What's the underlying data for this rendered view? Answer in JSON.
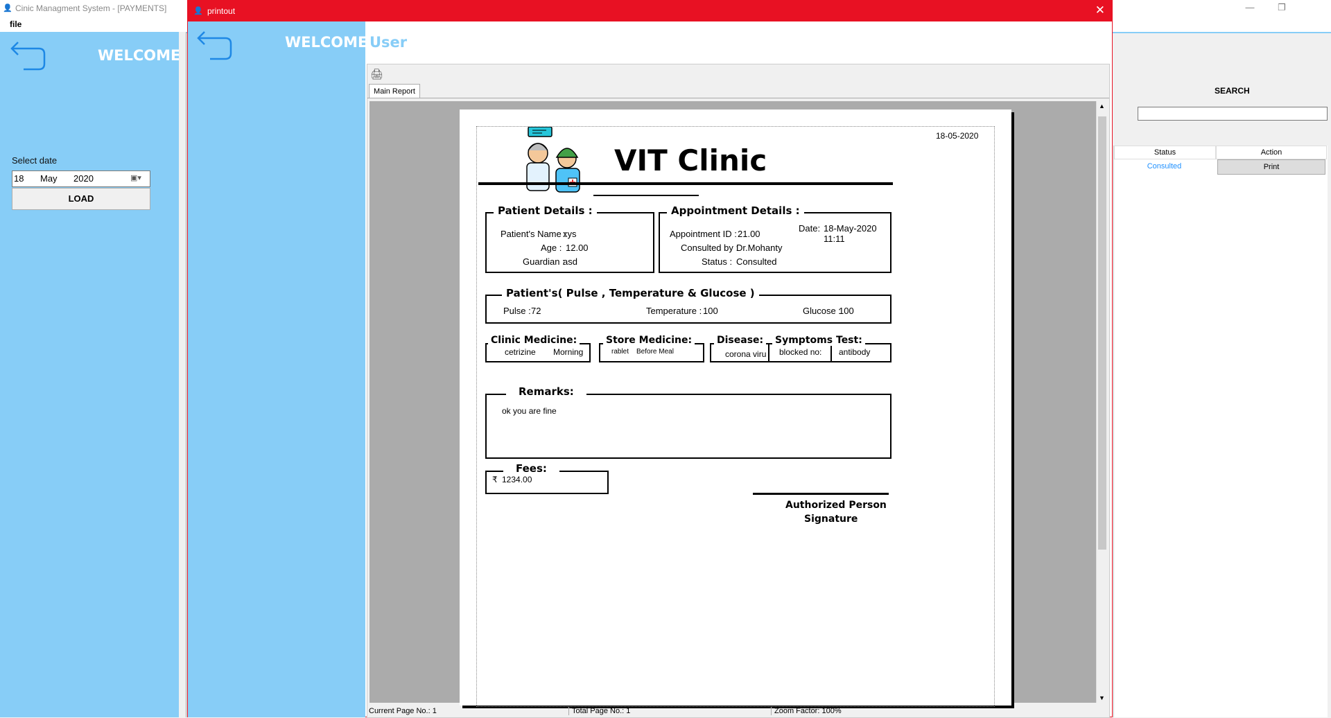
{
  "main_window": {
    "title": "Cinic Managment System - [PAYMENTS]",
    "menu": {
      "file": "file"
    },
    "welcome": "WELCOME",
    "select_date_label": "Select date",
    "date": {
      "day": "18",
      "month": "May",
      "year": "2020"
    },
    "load_button": "LOAD",
    "search_title": "SEARCH",
    "grid": {
      "columns": [
        "Status",
        "Action"
      ],
      "rows": [
        {
          "status": "Consulted",
          "action": "Print"
        }
      ]
    },
    "colors": {
      "sidebar": "#87cdf7",
      "accent": "#e81123",
      "status_text": "#1e90ff"
    }
  },
  "dialog": {
    "title": "printout",
    "welcome": "WELCOME",
    "user": "User",
    "tab_main_report": "Main Report",
    "status": {
      "current_page": "Current Page No.: 1",
      "total_page": "Total Page No.: 1",
      "zoom": "Zoom Factor: 100%"
    }
  },
  "report": {
    "date": "18-05-2020",
    "clinic_name": "VIT Clinic",
    "patient_details": {
      "header": "Patient Details :",
      "name_label": "Patient's Name :",
      "name": "xys",
      "age_label": "Age :",
      "age": "12.00",
      "guardian_label": "Guardian :",
      "guardian": "asd"
    },
    "appointment_details": {
      "header": "Appointment Details :",
      "id_label": "Appointment ID :",
      "id": "21.00",
      "consulted_label": "Consulted by :",
      "consulted_by": "Dr.Mohanty",
      "status_label": "Status :",
      "status": "Consulted",
      "date_label": "Date:",
      "date": "18-May-2020 11:11"
    },
    "vitals": {
      "header": "Patient's( Pulse , Temperature & Glucose )",
      "pulse_label": "Pulse :",
      "pulse": "72",
      "temp_label": "Temperature :",
      "temperature": "100",
      "glucose_label": "Glucose :",
      "glucose": "100"
    },
    "clinic_medicine": {
      "header": "Clinic Medicine:",
      "name": "cetrizine",
      "timing": "Morning"
    },
    "store_medicine": {
      "header": "Store Medicine:",
      "name": "rablet",
      "timing": "Before Meal"
    },
    "disease": {
      "header": "Disease:",
      "value": "corona viru"
    },
    "symptoms": {
      "header": "Symptoms:",
      "value": "blocked no:"
    },
    "test": {
      "header": "Test:",
      "value": "antibody"
    },
    "remarks": {
      "header": "Remarks:",
      "value": "ok you are fine"
    },
    "fees": {
      "header": "Fees:",
      "currency": "₹",
      "value": "1234.00"
    },
    "signature": {
      "line1": "Authorized Person",
      "line2": "Signature"
    }
  }
}
